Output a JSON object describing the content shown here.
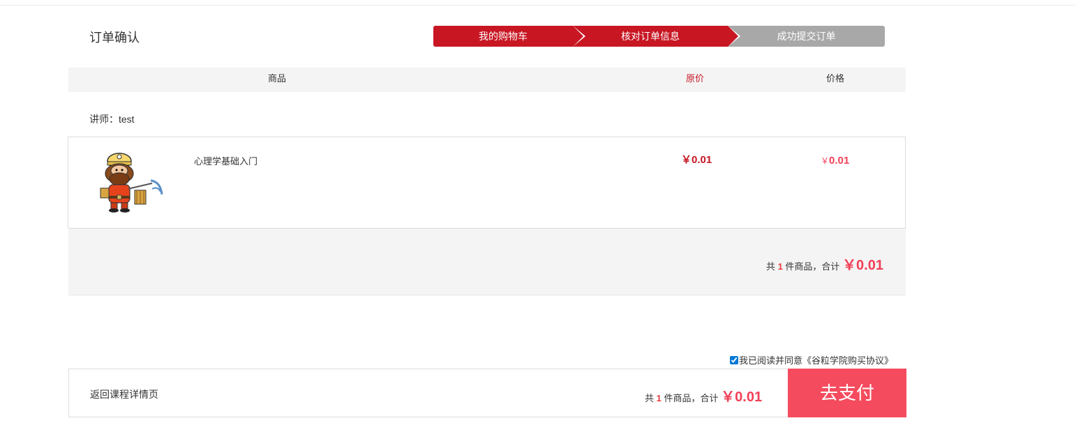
{
  "page": {
    "title": "订单确认"
  },
  "steps": [
    {
      "label": "我的购物车",
      "state": "active"
    },
    {
      "label": "核对订单信息",
      "state": "active"
    },
    {
      "label": "成功提交订单",
      "state": "inactive"
    }
  ],
  "table": {
    "headers": {
      "goods": "商品",
      "original_price": "原价",
      "price": "价格"
    }
  },
  "teacher": {
    "label": "讲师：test"
  },
  "item": {
    "thumbnail_icon": "cartoon-miner-icon",
    "name": "心理学基础入门",
    "original_price": "￥0.01",
    "price_currency": "￥",
    "price_value": "0.01"
  },
  "summary": {
    "prefix": "共",
    "count": "1",
    "middle": "件商品，合计",
    "total": "￥0.01"
  },
  "agreement": {
    "checked": true,
    "text": "我已阅读并同意《谷粒学院购买协议》"
  },
  "bottom": {
    "back_label": "返回课程详情页",
    "prefix": "共",
    "count": "1",
    "middle": "件商品，合计",
    "total": "￥0.01",
    "pay_label": "去支付"
  },
  "colors": {
    "active_step": "#c81623",
    "inactive_step": "#a8a8a8",
    "price_red": "#f23f57",
    "pay_button": "#f54b5e"
  }
}
